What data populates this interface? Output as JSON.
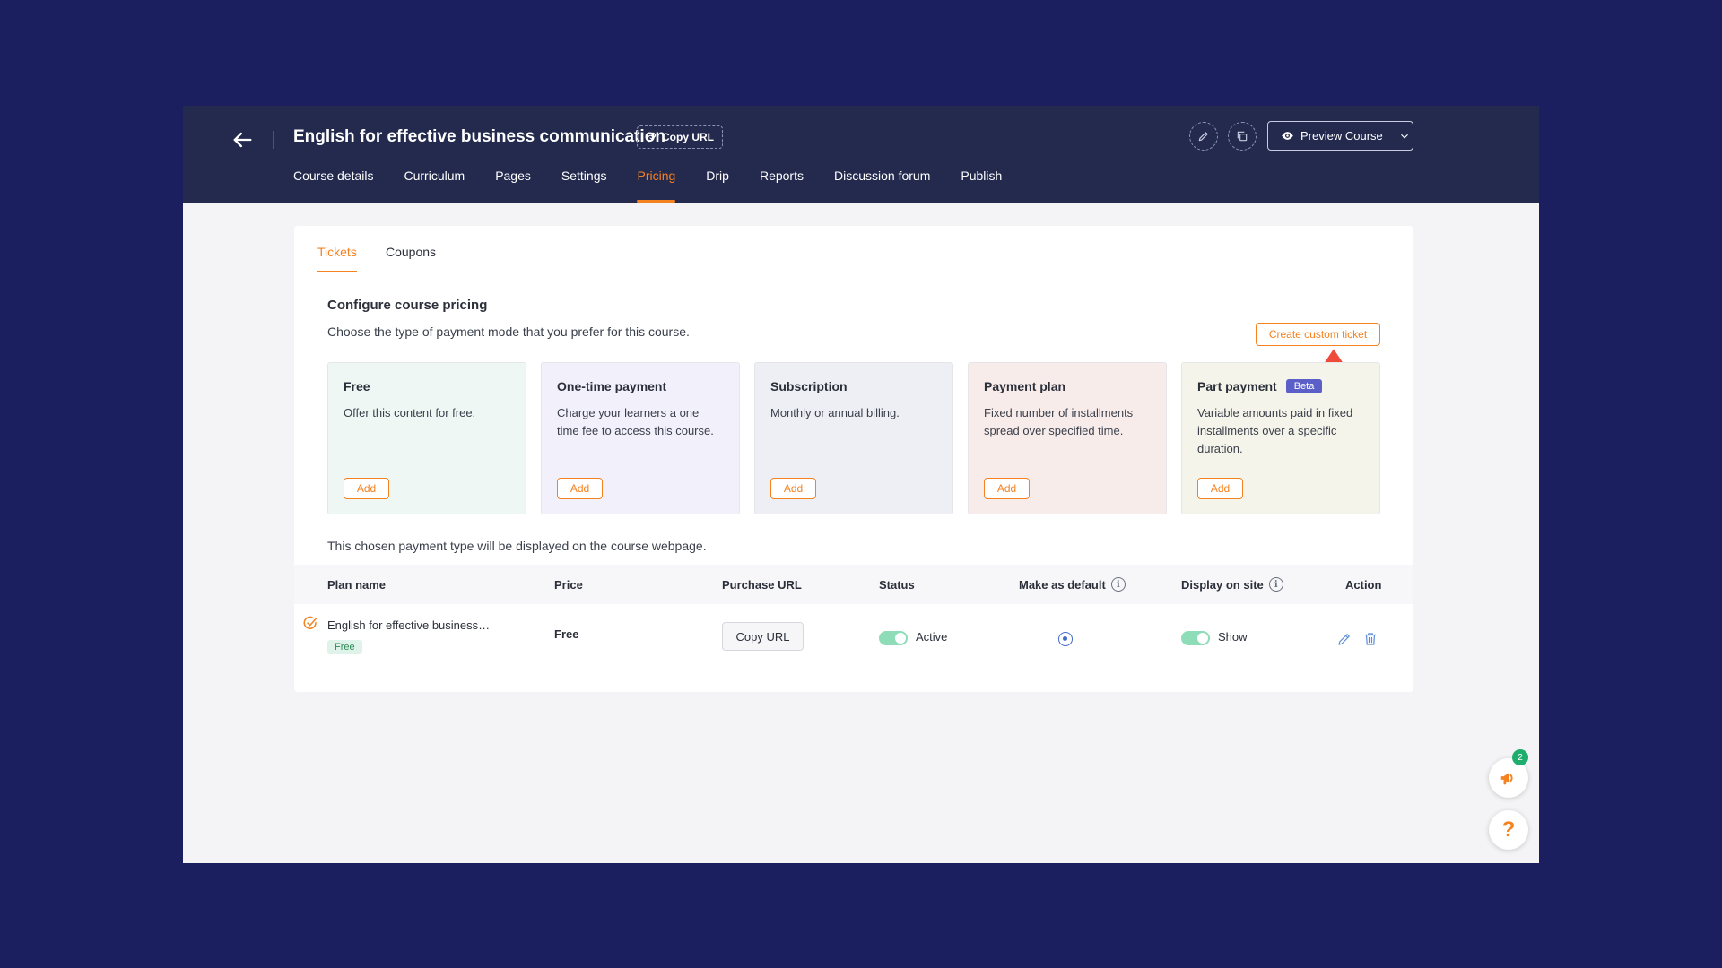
{
  "header": {
    "course_title": "English for effective business communication",
    "copy_url_label": "Copy URL",
    "preview_label": "Preview Course",
    "nav": [
      "Course details",
      "Curriculum",
      "Pages",
      "Settings",
      "Pricing",
      "Drip",
      "Reports",
      "Discussion forum",
      "Publish"
    ],
    "active_nav": "Pricing"
  },
  "subtabs": {
    "tickets": "Tickets",
    "coupons": "Coupons",
    "active": "Tickets"
  },
  "config": {
    "title": "Configure course pricing",
    "subtitle": "Choose the type of payment mode that you prefer for this course.",
    "create_button": "Create custom ticket"
  },
  "payment_types": [
    {
      "name": "Free",
      "desc": "Offer this content for free.",
      "add": "Add",
      "bg": "#eef7f3"
    },
    {
      "name": "One-time payment",
      "desc": "Charge your learners a one time fee to access this course.",
      "add": "Add",
      "bg": "#f1f0fb"
    },
    {
      "name": "Subscription",
      "desc": "Monthly or annual billing.",
      "add": "Add",
      "bg": "#edeff4"
    },
    {
      "name": "Payment plan",
      "desc": "Fixed number of installments spread over specified time.",
      "add": "Add",
      "bg": "#f8ecea"
    },
    {
      "name": "Part payment",
      "badge": "Beta",
      "desc": "Variable amounts paid in fixed installments over a specific duration.",
      "add": "Add",
      "bg": "#f5f4ea"
    }
  ],
  "chosen_note": "This chosen payment type will be displayed on the course webpage.",
  "table": {
    "headers": {
      "plan_name": "Plan name",
      "price": "Price",
      "purchase_url": "Purchase URL",
      "status": "Status",
      "make_default": "Make as default",
      "display_on_site": "Display on site",
      "action": "Action"
    },
    "info_glyph": "i",
    "row": {
      "plan_name": "English for effective business…",
      "badge": "Free",
      "price": "Free",
      "copy_url": "Copy URL",
      "status": "Active",
      "status_on": true,
      "is_default": true,
      "display": "Show",
      "display_on": true
    }
  },
  "floating": {
    "notifications_count": "2",
    "help": "?"
  },
  "colors": {
    "accent": "#f58220",
    "header_bg": "#232a4e",
    "page_bg": "#1b1f60",
    "toggle_on": "#8fdcb8",
    "link_blue": "#5b8ad6"
  }
}
